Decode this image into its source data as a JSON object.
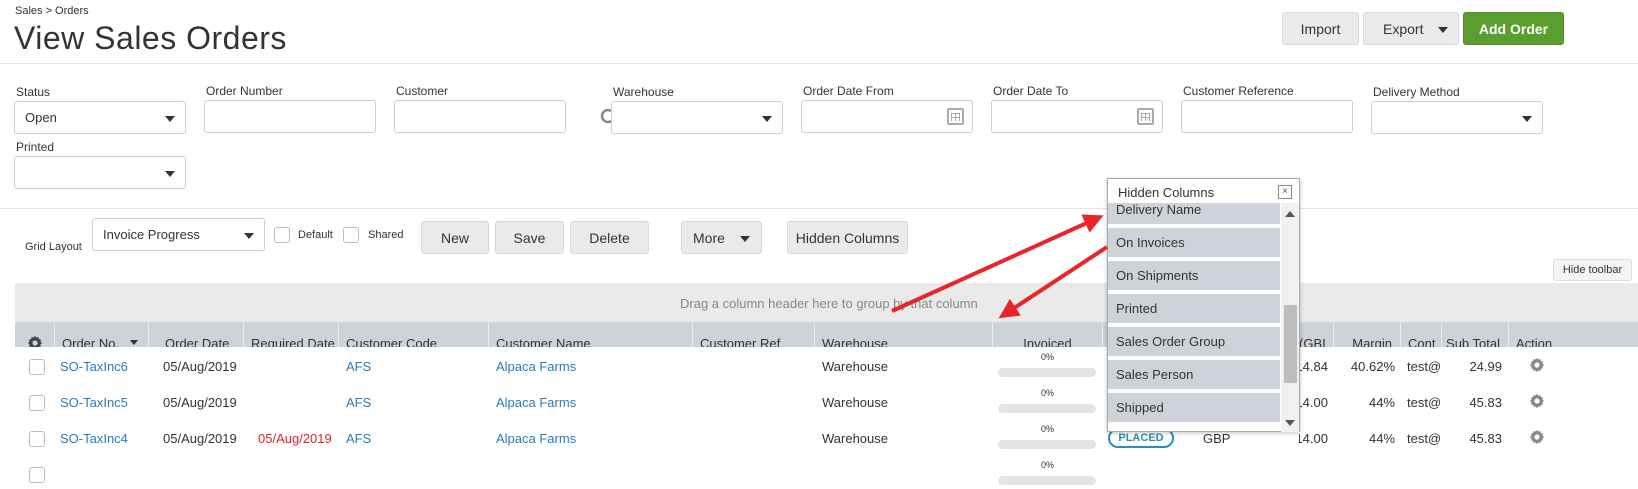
{
  "breadcrumb": "Sales > Orders",
  "page_title": "View Sales Orders",
  "header_buttons": {
    "import": "Import",
    "export": "Export",
    "add_order": "Add Order"
  },
  "filters": {
    "status": {
      "label": "Status",
      "value": "Open"
    },
    "order_number": {
      "label": "Order Number",
      "value": ""
    },
    "customer": {
      "label": "Customer",
      "value": ""
    },
    "warehouse": {
      "label": "Warehouse",
      "value": ""
    },
    "order_date_from": {
      "label": "Order Date From",
      "value": ""
    },
    "order_date_to": {
      "label": "Order Date To",
      "value": ""
    },
    "customer_reference": {
      "label": "Customer Reference",
      "value": ""
    },
    "delivery_method": {
      "label": "Delivery Method",
      "value": ""
    },
    "printed": {
      "label": "Printed",
      "value": ""
    }
  },
  "toolbar": {
    "grid_layout_label": "Grid Layout",
    "grid_layout_value": "Invoice Progress",
    "default_label": "Default",
    "shared_label": "Shared",
    "new": "New",
    "save": "Save",
    "delete": "Delete",
    "more": "More",
    "hidden_columns": "Hidden Columns",
    "hide_toolbar": "Hide toolbar"
  },
  "group_bar_text": "Drag a column header here to group by that column",
  "columns": {
    "order_no": "Order No.",
    "order_date": "Order Date",
    "required_date": "Required Date",
    "customer_code": "Customer Code",
    "customer_name": "Customer Name",
    "customer_ref": "Customer Ref",
    "warehouse": "Warehouse",
    "invoiced": "Invoiced",
    "currency": "(GBI",
    "margin": "Margin",
    "contact": "Cont",
    "sub_total": "Sub Total",
    "action": "Action"
  },
  "rows": [
    {
      "order_no": "SO-TaxInc6",
      "order_date": "05/Aug/2019",
      "required_date": "",
      "customer_code": "AFS",
      "customer_name": "Alpaca Farms",
      "warehouse": "Warehouse",
      "invoiced_pct": "0%",
      "invoiced_fraction": 0,
      "status": "",
      "currency": "",
      "amount": "14.84",
      "margin": "40.62%",
      "contact": "test@u",
      "sub_total": "24.99"
    },
    {
      "order_no": "SO-TaxInc5",
      "order_date": "05/Aug/2019",
      "required_date": "",
      "customer_code": "AFS",
      "customer_name": "Alpaca Farms",
      "warehouse": "Warehouse",
      "invoiced_pct": "0%",
      "invoiced_fraction": 0,
      "status": "",
      "currency": "",
      "amount": "14.00",
      "margin": "44%",
      "contact": "test@u",
      "sub_total": "45.83"
    },
    {
      "order_no": "SO-TaxInc4",
      "order_date": "05/Aug/2019",
      "required_date": "05/Aug/2019",
      "customer_code": "AFS",
      "customer_name": "Alpaca Farms",
      "warehouse": "Warehouse",
      "invoiced_pct": "0%",
      "invoiced_fraction": 0,
      "status": "PLACED",
      "currency": "GBP",
      "amount": "14.00",
      "margin": "44%",
      "contact": "test@u",
      "sub_total": "45.83"
    },
    {
      "order_no": "",
      "order_date": "",
      "required_date": "",
      "customer_code": "",
      "customer_name": "",
      "warehouse": "",
      "invoiced_pct": "0%",
      "invoiced_fraction": 0,
      "status": "",
      "currency": "",
      "amount": "",
      "margin": "",
      "contact": "",
      "sub_total": ""
    }
  ],
  "hidden_columns_popup": {
    "title": "Hidden Columns",
    "close": "×",
    "items": [
      "Delivery Name",
      "On Invoices",
      "On Shipments",
      "Printed",
      "Sales Order Group",
      "Sales Person",
      "Shipped"
    ]
  },
  "icons": {
    "search": "search-icon",
    "calendar": "calendar-icon",
    "settings": "gear-icon"
  },
  "colors": {
    "accent_green": "#5a9e2f",
    "link_blue": "#2b7bb9",
    "required_red": "#e02424",
    "header_grey": "#cdd3d9",
    "annotation_red": "#e8262a"
  }
}
